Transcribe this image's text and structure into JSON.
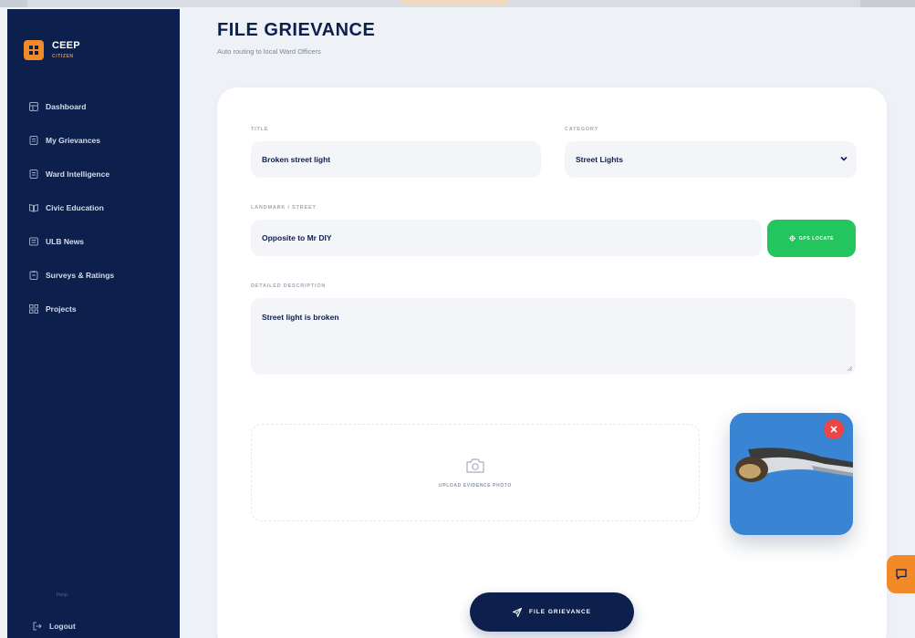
{
  "brand": {
    "name": "CEEP",
    "subtitle": "CITIZEN"
  },
  "sidebar": {
    "items": [
      {
        "label": "Dashboard",
        "icon": "grid-icon"
      },
      {
        "label": "My Grievances",
        "icon": "document-icon"
      },
      {
        "label": "Ward Intelligence",
        "icon": "document-icon"
      },
      {
        "label": "Civic Education",
        "icon": "book-icon"
      },
      {
        "label": "ULB News",
        "icon": "newspaper-icon"
      },
      {
        "label": "Surveys & Ratings",
        "icon": "clipboard-icon"
      },
      {
        "label": "Projects",
        "icon": "projects-icon"
      }
    ],
    "footer_label": "Help",
    "logout_label": "Logout"
  },
  "header": {
    "title": "FILE GRIEVANCE",
    "subtitle": "Auto routing to local Ward Officers"
  },
  "form": {
    "title_label": "TITLE",
    "title_value": "Broken street light",
    "category_label": "CATEGORY",
    "category_value": "Street Lights",
    "landmark_label": "LANDMARK / STREET",
    "landmark_value": "Opposite to Mr DIY",
    "gps_button_label": "GPS LOCATE",
    "description_label": "DETAILED DESCRIPTION",
    "description_value": "Street light is broken",
    "upload_label": "UPLOAD EVIDENCE PHOTO",
    "submit_label": "FILE GRIEVANCE"
  },
  "colors": {
    "sidebar": "#0c1f4d",
    "accent": "#f28a28",
    "gps_button": "#22c55e",
    "remove_badge": "#ef4444",
    "background": "#eef1f6"
  }
}
